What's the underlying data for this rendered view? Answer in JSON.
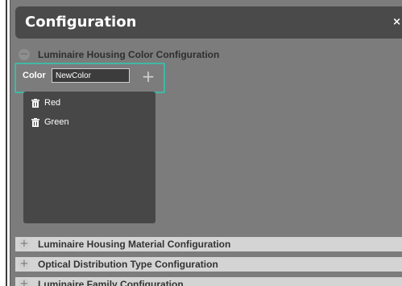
{
  "dialog": {
    "title": "Configuration",
    "close_label": "×"
  },
  "sections": [
    {
      "label": "Luminaire Housing Color Configuration",
      "state": "expanded",
      "icon": "minus-circle-icon"
    },
    {
      "label": "Luminaire Housing Material Configuration",
      "state": "collapsed",
      "icon": "plus-icon"
    },
    {
      "label": "Optical Distribution Type Configuration",
      "state": "collapsed",
      "icon": "plus-icon"
    },
    {
      "label": "Luminaire Family Configuration",
      "state": "collapsed",
      "icon": "plus-icon"
    }
  ],
  "color_editor": {
    "label": "Color",
    "input_value": "NewColor",
    "add_symbol": "+",
    "accent_color": "#3fb9a6"
  },
  "colors": [
    {
      "label": "Red",
      "icon": "trash-icon"
    },
    {
      "label": "Green",
      "icon": "trash-icon"
    }
  ]
}
